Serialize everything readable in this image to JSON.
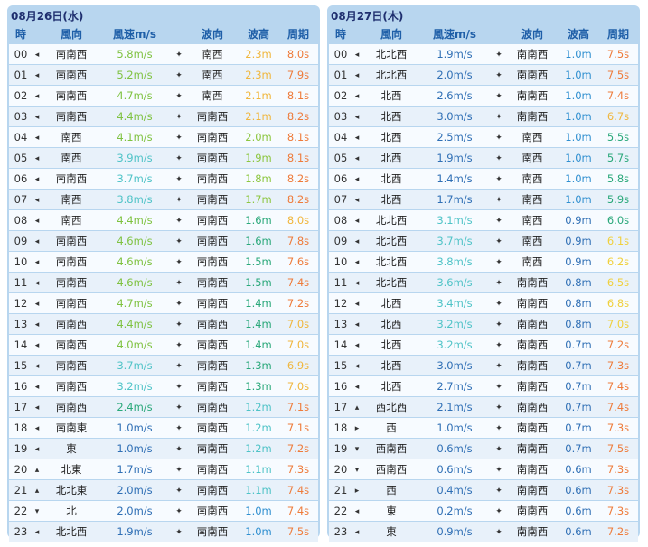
{
  "colors": {
    "panel": "#b8d6ef",
    "header_text": "#1f5fa8",
    "title_text": "#1f2f6f"
  },
  "icons": {
    "wind": "wind-direction-arrow-icon",
    "wave": "wave-direction-arrow-icon"
  },
  "days": [
    {
      "title": "08月26日(水)",
      "headers": {
        "hour": "時",
        "wind_dir": "風向",
        "wind_speed": "風速m/s",
        "wave_dir": "波向",
        "wave_height": "波高",
        "period": "周期"
      },
      "rows": [
        {
          "hour": "00",
          "arrow": "◂",
          "wind_dir": "南南西",
          "wind_speed": "5.8m/s",
          "wind_color": "#7fc241",
          "warrow": "✦",
          "wave_dir": "南西",
          "wave_height": "2.3m",
          "wh_color": "#f0b63c",
          "period": "8.0s",
          "p_color": "#ee7b3a"
        },
        {
          "hour": "01",
          "arrow": "◂",
          "wind_dir": "南南西",
          "wind_speed": "5.2m/s",
          "wind_color": "#7fc241",
          "warrow": "✦",
          "wave_dir": "南西",
          "wave_height": "2.3m",
          "wh_color": "#f0b63c",
          "period": "7.9s",
          "p_color": "#ee7b3a"
        },
        {
          "hour": "02",
          "arrow": "◂",
          "wind_dir": "南南西",
          "wind_speed": "4.7m/s",
          "wind_color": "#7fc241",
          "warrow": "✦",
          "wave_dir": "南西",
          "wave_height": "2.1m",
          "wh_color": "#f0b63c",
          "period": "8.1s",
          "p_color": "#ee7b3a"
        },
        {
          "hour": "03",
          "arrow": "◂",
          "wind_dir": "南南西",
          "wind_speed": "4.4m/s",
          "wind_color": "#7fc241",
          "warrow": "✦",
          "wave_dir": "南南西",
          "wave_height": "2.1m",
          "wh_color": "#f0b63c",
          "period": "8.2s",
          "p_color": "#ee7b3a"
        },
        {
          "hour": "04",
          "arrow": "◂",
          "wind_dir": "南西",
          "wind_speed": "4.1m/s",
          "wind_color": "#7fc241",
          "warrow": "✦",
          "wave_dir": "南南西",
          "wave_height": "2.0m",
          "wh_color": "#8cc63f",
          "period": "8.1s",
          "p_color": "#ee7b3a"
        },
        {
          "hour": "05",
          "arrow": "◂",
          "wind_dir": "南西",
          "wind_speed": "3.9m/s",
          "wind_color": "#4fc3c7",
          "warrow": "✦",
          "wave_dir": "南南西",
          "wave_height": "1.9m",
          "wh_color": "#8cc63f",
          "period": "8.1s",
          "p_color": "#ee7b3a"
        },
        {
          "hour": "06",
          "arrow": "◂",
          "wind_dir": "南南西",
          "wind_speed": "3.7m/s",
          "wind_color": "#4fc3c7",
          "warrow": "✦",
          "wave_dir": "南南西",
          "wave_height": "1.8m",
          "wh_color": "#8cc63f",
          "period": "8.2s",
          "p_color": "#ee7b3a"
        },
        {
          "hour": "07",
          "arrow": "◂",
          "wind_dir": "南西",
          "wind_speed": "3.8m/s",
          "wind_color": "#4fc3c7",
          "warrow": "✦",
          "wave_dir": "南南西",
          "wave_height": "1.7m",
          "wh_color": "#8cc63f",
          "period": "8.2s",
          "p_color": "#ee7b3a"
        },
        {
          "hour": "08",
          "arrow": "◂",
          "wind_dir": "南西",
          "wind_speed": "4.4m/s",
          "wind_color": "#7fc241",
          "warrow": "✦",
          "wave_dir": "南南西",
          "wave_height": "1.6m",
          "wh_color": "#2aa87a",
          "period": "8.0s",
          "p_color": "#f0b63c"
        },
        {
          "hour": "09",
          "arrow": "◂",
          "wind_dir": "南南西",
          "wind_speed": "4.6m/s",
          "wind_color": "#7fc241",
          "warrow": "✦",
          "wave_dir": "南南西",
          "wave_height": "1.6m",
          "wh_color": "#2aa87a",
          "period": "7.8s",
          "p_color": "#ee7b3a"
        },
        {
          "hour": "10",
          "arrow": "◂",
          "wind_dir": "南南西",
          "wind_speed": "4.6m/s",
          "wind_color": "#7fc241",
          "warrow": "✦",
          "wave_dir": "南南西",
          "wave_height": "1.5m",
          "wh_color": "#2aa87a",
          "period": "7.6s",
          "p_color": "#ee7b3a"
        },
        {
          "hour": "11",
          "arrow": "◂",
          "wind_dir": "南南西",
          "wind_speed": "4.6m/s",
          "wind_color": "#7fc241",
          "warrow": "✦",
          "wave_dir": "南南西",
          "wave_height": "1.5m",
          "wh_color": "#2aa87a",
          "period": "7.4s",
          "p_color": "#ee7b3a"
        },
        {
          "hour": "12",
          "arrow": "◂",
          "wind_dir": "南南西",
          "wind_speed": "4.7m/s",
          "wind_color": "#7fc241",
          "warrow": "✦",
          "wave_dir": "南南西",
          "wave_height": "1.4m",
          "wh_color": "#2aa87a",
          "period": "7.2s",
          "p_color": "#ee7b3a"
        },
        {
          "hour": "13",
          "arrow": "◂",
          "wind_dir": "南南西",
          "wind_speed": "4.4m/s",
          "wind_color": "#7fc241",
          "warrow": "✦",
          "wave_dir": "南南西",
          "wave_height": "1.4m",
          "wh_color": "#2aa87a",
          "period": "7.0s",
          "p_color": "#f0b63c"
        },
        {
          "hour": "14",
          "arrow": "◂",
          "wind_dir": "南南西",
          "wind_speed": "4.0m/s",
          "wind_color": "#7fc241",
          "warrow": "✦",
          "wave_dir": "南南西",
          "wave_height": "1.4m",
          "wh_color": "#2aa87a",
          "period": "7.0s",
          "p_color": "#f0b63c"
        },
        {
          "hour": "15",
          "arrow": "◂",
          "wind_dir": "南南西",
          "wind_speed": "3.7m/s",
          "wind_color": "#4fc3c7",
          "warrow": "✦",
          "wave_dir": "南南西",
          "wave_height": "1.3m",
          "wh_color": "#2aa87a",
          "period": "6.9s",
          "p_color": "#f0b63c"
        },
        {
          "hour": "16",
          "arrow": "◂",
          "wind_dir": "南南西",
          "wind_speed": "3.2m/s",
          "wind_color": "#4fc3c7",
          "warrow": "✦",
          "wave_dir": "南南西",
          "wave_height": "1.3m",
          "wh_color": "#2aa87a",
          "period": "7.0s",
          "p_color": "#f0b63c"
        },
        {
          "hour": "17",
          "arrow": "◂",
          "wind_dir": "南南西",
          "wind_speed": "2.4m/s",
          "wind_color": "#2aa87a",
          "warrow": "✦",
          "wave_dir": "南南西",
          "wave_height": "1.2m",
          "wh_color": "#4fc3c7",
          "period": "7.1s",
          "p_color": "#ee7b3a"
        },
        {
          "hour": "18",
          "arrow": "◂",
          "wind_dir": "南南東",
          "wind_speed": "1.0m/s",
          "wind_color": "#2f6fb5",
          "warrow": "✦",
          "wave_dir": "南南西",
          "wave_height": "1.2m",
          "wh_color": "#4fc3c7",
          "period": "7.1s",
          "p_color": "#ee7b3a"
        },
        {
          "hour": "19",
          "arrow": "◂",
          "wind_dir": "東",
          "wind_speed": "1.0m/s",
          "wind_color": "#2f6fb5",
          "warrow": "✦",
          "wave_dir": "南南西",
          "wave_height": "1.2m",
          "wh_color": "#4fc3c7",
          "period": "7.2s",
          "p_color": "#ee7b3a"
        },
        {
          "hour": "20",
          "arrow": "▴",
          "wind_dir": "北東",
          "wind_speed": "1.7m/s",
          "wind_color": "#2f6fb5",
          "warrow": "✦",
          "wave_dir": "南南西",
          "wave_height": "1.1m",
          "wh_color": "#4fc3c7",
          "period": "7.3s",
          "p_color": "#ee7b3a"
        },
        {
          "hour": "21",
          "arrow": "▴",
          "wind_dir": "北北東",
          "wind_speed": "2.0m/s",
          "wind_color": "#2f6fb5",
          "warrow": "✦",
          "wave_dir": "南南西",
          "wave_height": "1.1m",
          "wh_color": "#4fc3c7",
          "period": "7.4s",
          "p_color": "#ee7b3a"
        },
        {
          "hour": "22",
          "arrow": "▾",
          "wind_dir": "北",
          "wind_speed": "2.0m/s",
          "wind_color": "#2f6fb5",
          "warrow": "✦",
          "wave_dir": "南南西",
          "wave_height": "1.0m",
          "wh_color": "#2f8fd0",
          "period": "7.4s",
          "p_color": "#ee7b3a"
        },
        {
          "hour": "23",
          "arrow": "◂",
          "wind_dir": "北北西",
          "wind_speed": "1.9m/s",
          "wind_color": "#2f6fb5",
          "warrow": "✦",
          "wave_dir": "南南西",
          "wave_height": "1.0m",
          "wh_color": "#2f8fd0",
          "period": "7.5s",
          "p_color": "#ee7b3a"
        }
      ]
    },
    {
      "title": "08月27日(木)",
      "headers": {
        "hour": "時",
        "wind_dir": "風向",
        "wind_speed": "風速m/s",
        "wave_dir": "波向",
        "wave_height": "波高",
        "period": "周期"
      },
      "rows": [
        {
          "hour": "00",
          "arrow": "◂",
          "wind_dir": "北北西",
          "wind_speed": "1.9m/s",
          "wind_color": "#2f6fb5",
          "warrow": "✦",
          "wave_dir": "南南西",
          "wave_height": "1.0m",
          "wh_color": "#2f8fd0",
          "period": "7.5s",
          "p_color": "#ee7b3a"
        },
        {
          "hour": "01",
          "arrow": "◂",
          "wind_dir": "北北西",
          "wind_speed": "2.0m/s",
          "wind_color": "#2f6fb5",
          "warrow": "✦",
          "wave_dir": "南南西",
          "wave_height": "1.0m",
          "wh_color": "#2f8fd0",
          "period": "7.5s",
          "p_color": "#ee7b3a"
        },
        {
          "hour": "02",
          "arrow": "◂",
          "wind_dir": "北西",
          "wind_speed": "2.6m/s",
          "wind_color": "#2f6fb5",
          "warrow": "✦",
          "wave_dir": "南南西",
          "wave_height": "1.0m",
          "wh_color": "#2f8fd0",
          "period": "7.4s",
          "p_color": "#ee7b3a"
        },
        {
          "hour": "03",
          "arrow": "◂",
          "wind_dir": "北西",
          "wind_speed": "3.0m/s",
          "wind_color": "#2f6fb5",
          "warrow": "✦",
          "wave_dir": "南南西",
          "wave_height": "1.0m",
          "wh_color": "#2f8fd0",
          "period": "6.7s",
          "p_color": "#f0b63c"
        },
        {
          "hour": "04",
          "arrow": "◂",
          "wind_dir": "北西",
          "wind_speed": "2.5m/s",
          "wind_color": "#2f6fb5",
          "warrow": "✦",
          "wave_dir": "南西",
          "wave_height": "1.0m",
          "wh_color": "#2f8fd0",
          "period": "5.5s",
          "p_color": "#2aa87a"
        },
        {
          "hour": "05",
          "arrow": "◂",
          "wind_dir": "北西",
          "wind_speed": "1.9m/s",
          "wind_color": "#2f6fb5",
          "warrow": "✦",
          "wave_dir": "南西",
          "wave_height": "1.0m",
          "wh_color": "#2f8fd0",
          "period": "5.7s",
          "p_color": "#2aa87a"
        },
        {
          "hour": "06",
          "arrow": "◂",
          "wind_dir": "北西",
          "wind_speed": "1.4m/s",
          "wind_color": "#2f6fb5",
          "warrow": "✦",
          "wave_dir": "南西",
          "wave_height": "1.0m",
          "wh_color": "#2f8fd0",
          "period": "5.8s",
          "p_color": "#2aa87a"
        },
        {
          "hour": "07",
          "arrow": "◂",
          "wind_dir": "北西",
          "wind_speed": "1.7m/s",
          "wind_color": "#2f6fb5",
          "warrow": "✦",
          "wave_dir": "南西",
          "wave_height": "1.0m",
          "wh_color": "#2f8fd0",
          "period": "5.9s",
          "p_color": "#2aa87a"
        },
        {
          "hour": "08",
          "arrow": "◂",
          "wind_dir": "北北西",
          "wind_speed": "3.1m/s",
          "wind_color": "#4fc3c7",
          "warrow": "✦",
          "wave_dir": "南西",
          "wave_height": "0.9m",
          "wh_color": "#2f6fb5",
          "period": "6.0s",
          "p_color": "#2aa87a"
        },
        {
          "hour": "09",
          "arrow": "◂",
          "wind_dir": "北北西",
          "wind_speed": "3.7m/s",
          "wind_color": "#4fc3c7",
          "warrow": "✦",
          "wave_dir": "南西",
          "wave_height": "0.9m",
          "wh_color": "#2f6fb5",
          "period": "6.1s",
          "p_color": "#f0d03c"
        },
        {
          "hour": "10",
          "arrow": "◂",
          "wind_dir": "北北西",
          "wind_speed": "3.8m/s",
          "wind_color": "#4fc3c7",
          "warrow": "✦",
          "wave_dir": "南西",
          "wave_height": "0.9m",
          "wh_color": "#2f6fb5",
          "period": "6.2s",
          "p_color": "#f0d03c"
        },
        {
          "hour": "11",
          "arrow": "◂",
          "wind_dir": "北北西",
          "wind_speed": "3.6m/s",
          "wind_color": "#4fc3c7",
          "warrow": "✦",
          "wave_dir": "南南西",
          "wave_height": "0.8m",
          "wh_color": "#2f6fb5",
          "period": "6.5s",
          "p_color": "#f0d03c"
        },
        {
          "hour": "12",
          "arrow": "◂",
          "wind_dir": "北西",
          "wind_speed": "3.4m/s",
          "wind_color": "#4fc3c7",
          "warrow": "✦",
          "wave_dir": "南南西",
          "wave_height": "0.8m",
          "wh_color": "#2f6fb5",
          "period": "6.8s",
          "p_color": "#f0d03c"
        },
        {
          "hour": "13",
          "arrow": "◂",
          "wind_dir": "北西",
          "wind_speed": "3.2m/s",
          "wind_color": "#4fc3c7",
          "warrow": "✦",
          "wave_dir": "南南西",
          "wave_height": "0.8m",
          "wh_color": "#2f6fb5",
          "period": "7.0s",
          "p_color": "#f0d03c"
        },
        {
          "hour": "14",
          "arrow": "◂",
          "wind_dir": "北西",
          "wind_speed": "3.2m/s",
          "wind_color": "#4fc3c7",
          "warrow": "✦",
          "wave_dir": "南南西",
          "wave_height": "0.7m",
          "wh_color": "#2f6fb5",
          "period": "7.2s",
          "p_color": "#ee7b3a"
        },
        {
          "hour": "15",
          "arrow": "◂",
          "wind_dir": "北西",
          "wind_speed": "3.0m/s",
          "wind_color": "#2f6fb5",
          "warrow": "✦",
          "wave_dir": "南南西",
          "wave_height": "0.7m",
          "wh_color": "#2f6fb5",
          "period": "7.3s",
          "p_color": "#ee7b3a"
        },
        {
          "hour": "16",
          "arrow": "◂",
          "wind_dir": "北西",
          "wind_speed": "2.7m/s",
          "wind_color": "#2f6fb5",
          "warrow": "✦",
          "wave_dir": "南南西",
          "wave_height": "0.7m",
          "wh_color": "#2f6fb5",
          "period": "7.4s",
          "p_color": "#ee7b3a"
        },
        {
          "hour": "17",
          "arrow": "▴",
          "wind_dir": "西北西",
          "wind_speed": "2.1m/s",
          "wind_color": "#2f6fb5",
          "warrow": "✦",
          "wave_dir": "南南西",
          "wave_height": "0.7m",
          "wh_color": "#2f6fb5",
          "period": "7.4s",
          "p_color": "#ee7b3a"
        },
        {
          "hour": "18",
          "arrow": "▸",
          "wind_dir": "西",
          "wind_speed": "1.0m/s",
          "wind_color": "#2f6fb5",
          "warrow": "✦",
          "wave_dir": "南南西",
          "wave_height": "0.7m",
          "wh_color": "#2f6fb5",
          "period": "7.3s",
          "p_color": "#ee7b3a"
        },
        {
          "hour": "19",
          "arrow": "▾",
          "wind_dir": "西南西",
          "wind_speed": "0.6m/s",
          "wind_color": "#2f6fb5",
          "warrow": "✦",
          "wave_dir": "南南西",
          "wave_height": "0.7m",
          "wh_color": "#2f6fb5",
          "period": "7.5s",
          "p_color": "#ee7b3a"
        },
        {
          "hour": "20",
          "arrow": "▾",
          "wind_dir": "西南西",
          "wind_speed": "0.6m/s",
          "wind_color": "#2f6fb5",
          "warrow": "✦",
          "wave_dir": "南南西",
          "wave_height": "0.6m",
          "wh_color": "#2f6fb5",
          "period": "7.3s",
          "p_color": "#ee7b3a"
        },
        {
          "hour": "21",
          "arrow": "▸",
          "wind_dir": "西",
          "wind_speed": "0.4m/s",
          "wind_color": "#2f6fb5",
          "warrow": "✦",
          "wave_dir": "南南西",
          "wave_height": "0.6m",
          "wh_color": "#2f6fb5",
          "period": "7.3s",
          "p_color": "#ee7b3a"
        },
        {
          "hour": "22",
          "arrow": "◂",
          "wind_dir": "東",
          "wind_speed": "0.2m/s",
          "wind_color": "#2f6fb5",
          "warrow": "✦",
          "wave_dir": "南南西",
          "wave_height": "0.6m",
          "wh_color": "#2f6fb5",
          "period": "7.3s",
          "p_color": "#ee7b3a"
        },
        {
          "hour": "23",
          "arrow": "◂",
          "wind_dir": "東",
          "wind_speed": "0.9m/s",
          "wind_color": "#2f6fb5",
          "warrow": "✦",
          "wave_dir": "南南西",
          "wave_height": "0.6m",
          "wh_color": "#2f6fb5",
          "period": "7.2s",
          "p_color": "#ee7b3a"
        }
      ]
    }
  ]
}
